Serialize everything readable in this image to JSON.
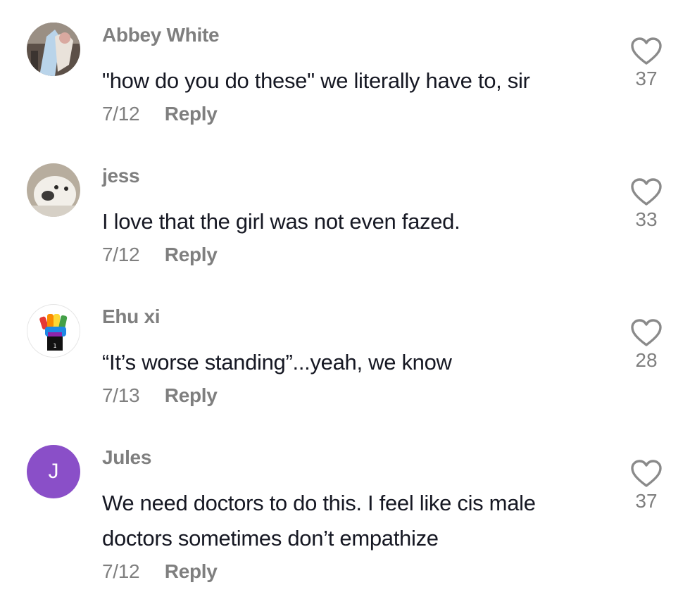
{
  "comments": [
    {
      "username": "Abbey White",
      "text": "\"how do you do these\" we literally have to, sir",
      "date": "7/12",
      "reply_label": "Reply",
      "likes": "37",
      "avatar_icon": "photo-avatar"
    },
    {
      "username": "jess",
      "text": "I love that the girl was not even fazed.",
      "date": "7/12",
      "reply_label": "Reply",
      "likes": "33",
      "avatar_icon": "dog-photo-avatar"
    },
    {
      "username": "Ehu xi",
      "text": "“It’s worse standing”...yeah, we know",
      "date": "7/13",
      "reply_label": "Reply",
      "likes": "28",
      "avatar_icon": "raised-fist-avatar"
    },
    {
      "username": "Jules",
      "text": "We need doctors to do this. I feel like cis male doctors sometimes don’t empathize",
      "date": "7/12",
      "reply_label": "Reply",
      "likes": "37",
      "avatar_letter": "J",
      "avatar_color": "#8a4fc8"
    }
  ],
  "colors": {
    "text_primary": "#161823",
    "text_secondary": "#7f7f7f",
    "heart_outline": "#8a8a8a"
  }
}
